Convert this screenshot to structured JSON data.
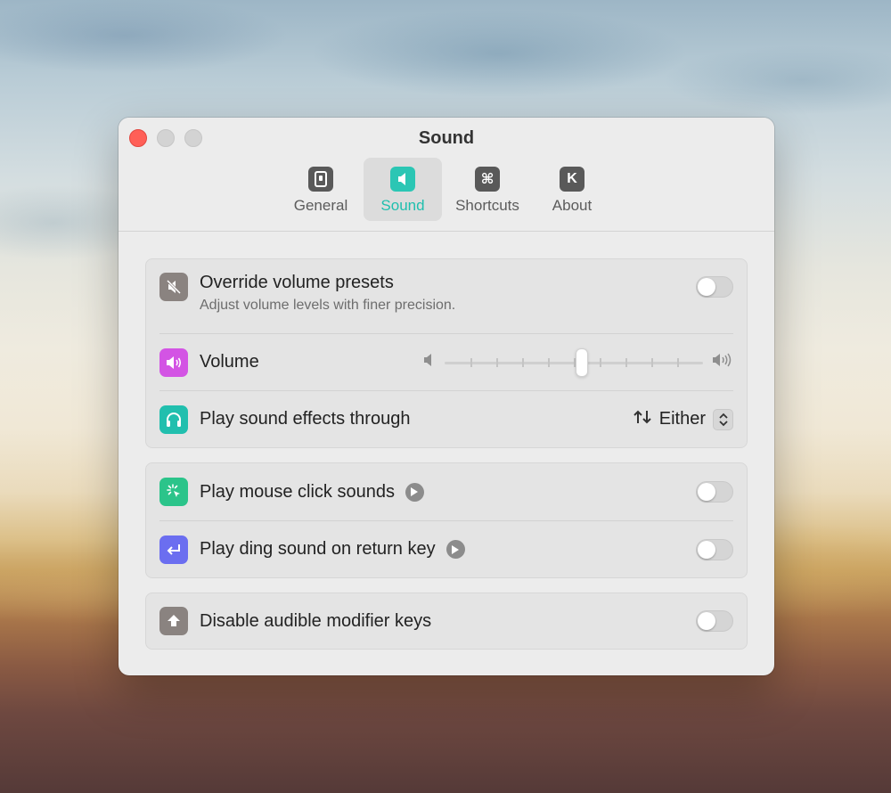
{
  "window": {
    "title": "Sound"
  },
  "tabs": [
    {
      "label": "General",
      "icon": "general-icon"
    },
    {
      "label": "Sound",
      "icon": "speaker-icon"
    },
    {
      "label": "Shortcuts",
      "icon": "command-icon",
      "glyph": "⌘"
    },
    {
      "label": "About",
      "icon": "about-icon",
      "glyph": "K"
    }
  ],
  "active_tab": "Sound",
  "accent_color": "#2bc6b4",
  "groups": {
    "volume": {
      "override": {
        "label": "Override volume presets",
        "description": "Adjust volume levels with finer precision.",
        "enabled": false,
        "icon": "speaker-muted-icon",
        "icon_color": "#8a8380"
      },
      "volume": {
        "label": "Volume",
        "level": 0.53,
        "steps": 10,
        "icon": "speaker-wave-icon",
        "icon_color": "#d354e4"
      },
      "output": {
        "label": "Play sound effects through",
        "value": "Either",
        "icon": "headphones-icon",
        "icon_color": "#21bfae"
      }
    },
    "feedback": {
      "mouse_click": {
        "label": "Play mouse click sounds",
        "enabled": false,
        "icon": "cursor-click-icon",
        "icon_color": "#2bc48a"
      },
      "return_ding": {
        "label": "Play ding sound on return key",
        "enabled": false,
        "icon": "return-key-icon",
        "icon_color": "#6b6ef0"
      }
    },
    "modifiers": {
      "disable_modifier": {
        "label": "Disable audible modifier keys",
        "enabled": false,
        "icon": "shift-key-icon",
        "icon_color": "#8a8380"
      }
    }
  }
}
